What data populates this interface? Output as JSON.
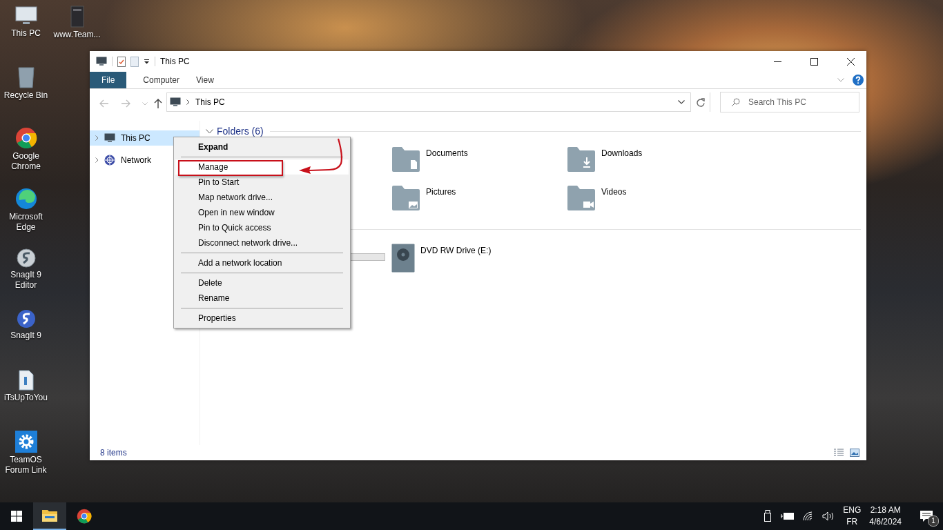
{
  "desktop": {
    "icons": [
      {
        "label": "This PC",
        "kind": "pc"
      },
      {
        "label": "Recycle Bin",
        "kind": "bin"
      },
      {
        "label": "Google Chrome",
        "kind": "chrome"
      },
      {
        "label": "Microsoft Edge",
        "kind": "edge"
      },
      {
        "label": "SnagIt 9 Editor",
        "kind": "snagit-editor"
      },
      {
        "label": "SnagIt 9",
        "kind": "snagit"
      },
      {
        "label": "iTsUpToYou",
        "kind": "file"
      },
      {
        "label": "TeamOS Forum Link",
        "kind": "gear"
      }
    ],
    "second_column": [
      {
        "label": "www.Team...",
        "kind": "book"
      }
    ]
  },
  "window": {
    "title": "This PC",
    "ribbon_tabs": [
      {
        "label": "File",
        "kind": "file-menu"
      },
      {
        "label": "Computer",
        "kind": "tab"
      },
      {
        "label": "View",
        "kind": "tab"
      }
    ],
    "address": {
      "path": "This PC"
    },
    "search": {
      "placeholder": "Search This PC"
    },
    "nav": [
      {
        "label": "This PC",
        "kind": "pc",
        "selected": true
      },
      {
        "label": "Network",
        "kind": "network",
        "selected": false
      }
    ],
    "folders_header": "Folders (6)",
    "folders": [
      {
        "name": "Documents",
        "kind": "documents"
      },
      {
        "name": "Downloads",
        "kind": "downloads"
      },
      {
        "name": "Pictures",
        "kind": "pictures"
      },
      {
        "name": "Videos",
        "kind": "videos"
      }
    ],
    "drives": [
      {
        "name": "DVD RW Drive (E:)"
      }
    ],
    "status": "8 items"
  },
  "context_menu": {
    "items": [
      {
        "kind": "item",
        "label": "Expand",
        "bold": true,
        "selected": false
      },
      {
        "kind": "separator"
      },
      {
        "kind": "item",
        "label": "Manage",
        "bold": false,
        "selected": true
      },
      {
        "kind": "item",
        "label": "Pin to Start",
        "bold": false,
        "selected": false
      },
      {
        "kind": "item",
        "label": "Map network drive...",
        "bold": false,
        "selected": false
      },
      {
        "kind": "item",
        "label": "Open in new window",
        "bold": false,
        "selected": false
      },
      {
        "kind": "item",
        "label": "Pin to Quick access",
        "bold": false,
        "selected": false
      },
      {
        "kind": "item",
        "label": "Disconnect network drive...",
        "bold": false,
        "selected": false
      },
      {
        "kind": "separator"
      },
      {
        "kind": "item",
        "label": "Add a network location",
        "bold": false,
        "selected": false
      },
      {
        "kind": "separator"
      },
      {
        "kind": "item",
        "label": "Delete",
        "bold": false,
        "selected": false
      },
      {
        "kind": "item",
        "label": "Rename",
        "bold": false,
        "selected": false
      },
      {
        "kind": "separator"
      },
      {
        "kind": "item",
        "label": "Properties",
        "bold": false,
        "selected": false
      }
    ]
  },
  "taskbar": {
    "apps": [
      {
        "kind": "explorer",
        "selected": true
      },
      {
        "kind": "chrome",
        "selected": false
      }
    ],
    "language": "ENG",
    "layout": "FR",
    "time": "2:18 AM",
    "date": "4/6/2024",
    "notification_count": "1"
  }
}
